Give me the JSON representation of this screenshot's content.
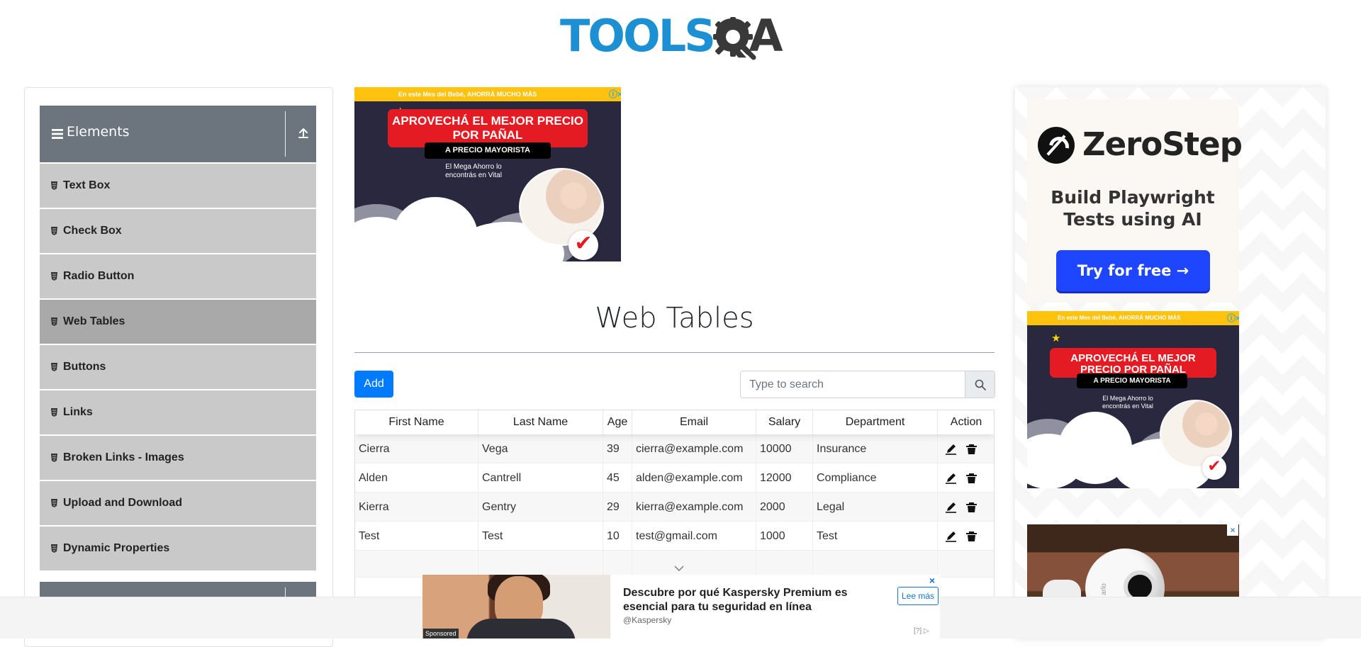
{
  "header": {
    "logo": "TOOLSQA"
  },
  "sidebar": {
    "group_title": "Elements",
    "items": [
      {
        "label": "Text Box",
        "active": false
      },
      {
        "label": "Check Box",
        "active": false
      },
      {
        "label": "Radio Button",
        "active": false
      },
      {
        "label": "Web Tables",
        "active": true
      },
      {
        "label": "Buttons",
        "active": false
      },
      {
        "label": "Links",
        "active": false
      },
      {
        "label": "Broken Links - Images",
        "active": false
      },
      {
        "label": "Upload and Download",
        "active": false
      },
      {
        "label": "Dynamic Properties",
        "active": false
      }
    ],
    "icons": {
      "menu": "bars-icon",
      "collapse": "upload-icon",
      "item": "html5-icon"
    }
  },
  "top_ad": {
    "strip": "En este Mes del Bebé, AHORRÁ MUCHO MÁS",
    "headline": "APROVECHÁ EL MEJOR PRECIO POR PAÑAL",
    "subheadline": "A PRECIO MAYORISTA",
    "copy": "El Mega Ahorro lo encontrás en Vital",
    "badge": "✔"
  },
  "main": {
    "title": "Web Tables",
    "add_button": "Add",
    "search": {
      "placeholder": "Type to search",
      "value": "",
      "icon": "search-icon"
    },
    "table": {
      "columns": [
        "First Name",
        "Last Name",
        "Age",
        "Email",
        "Salary",
        "Department",
        "Action"
      ],
      "rows": [
        [
          "Cierra",
          "Vega",
          "39",
          "cierra@example.com",
          "10000",
          "Insurance"
        ],
        [
          "Alden",
          "Cantrell",
          "45",
          "alden@example.com",
          "12000",
          "Compliance"
        ],
        [
          "Kierra",
          "Gentry",
          "29",
          "kierra@example.com",
          "2000",
          "Legal"
        ],
        [
          "Test",
          "Test",
          "10",
          "test@gmail.com",
          "1000",
          "Test"
        ]
      ],
      "row_actions": [
        "edit-icon",
        "delete-icon"
      ]
    }
  },
  "right_ads": {
    "zero_step": {
      "name": "ZeroStep",
      "tagline": "Build Playwright Tests using AI",
      "button": "Try for free →"
    },
    "second_ad": {
      "strip": "En este Mes del Bebé, AHORRÁ MUCHO MÁS",
      "headline": "APROVECHÁ EL MEJOR PRECIO POR PAÑAL",
      "subheadline": "A PRECIO MAYORISTA",
      "copy": "El Mega Ahorro lo encontrás en Vital",
      "badge": "✔"
    },
    "third_ad": {
      "close": "×",
      "camera_mark": "arlo"
    }
  },
  "bottom_ad": {
    "headline": "Descubre por qué Kaspersky Premium es esencial para tu seguridad en línea",
    "source": "@Kaspersky",
    "button": "Lee más",
    "sponsored": "Sponsored",
    "close": "×",
    "adchoice": "[?] ▷"
  },
  "colors": {
    "brand_blue": "#1d8fd3",
    "sidebar_header": "#6c757d",
    "sidebar_item": "#c9c9c9",
    "sidebar_active": "#a9a9a9",
    "primary": "#007bff",
    "zero_blue": "#1e45ff"
  }
}
